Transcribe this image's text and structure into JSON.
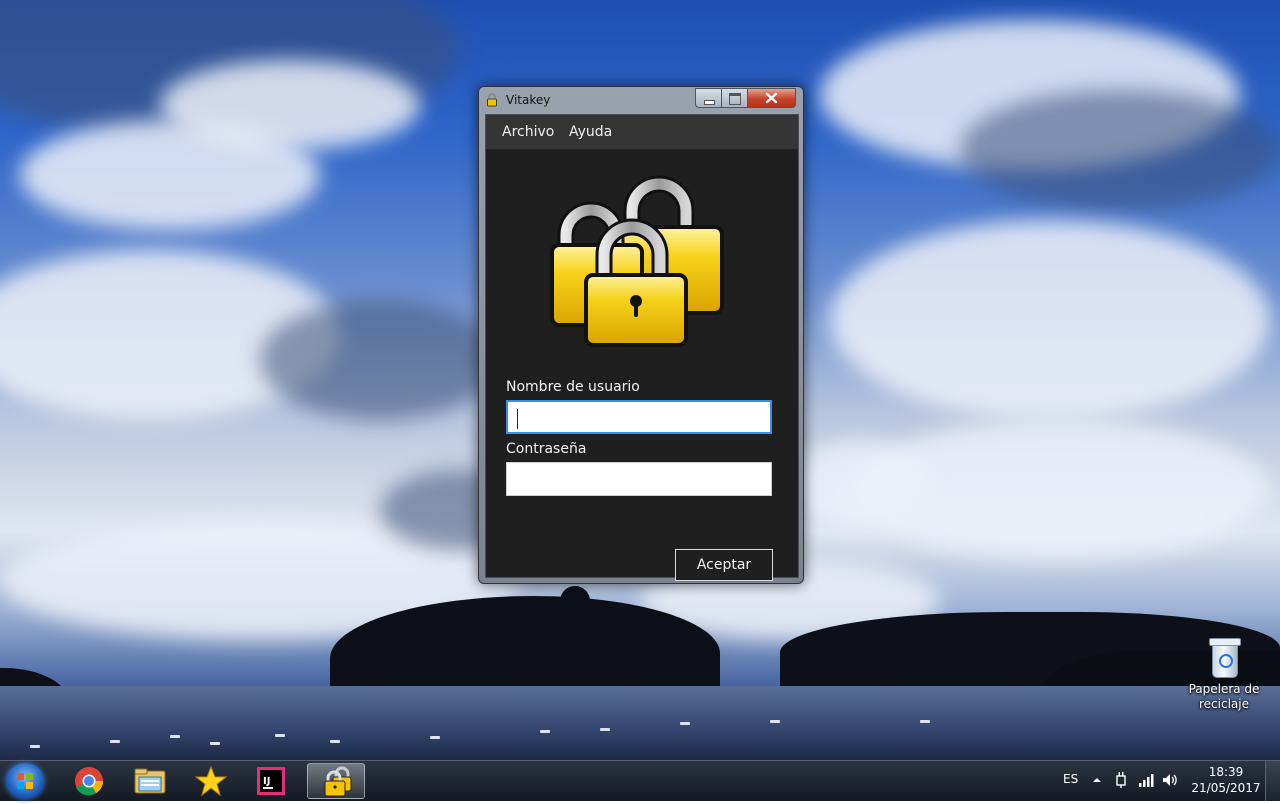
{
  "window": {
    "title": "Vitakey",
    "menu": [
      "Archivo",
      "Ayuda"
    ],
    "username_label": "Nombre de usuario",
    "username_value": "",
    "password_label": "Contraseña",
    "password_value": "",
    "accept_label": "Aceptar",
    "controls": {
      "minimize": "minimize-icon",
      "maximize": "maximize-icon",
      "close": "close-icon"
    },
    "icon": "padlocks-icon"
  },
  "desktop": {
    "recycle_bin_label": "Papelera de reciclaje"
  },
  "taskbar": {
    "pinned": [
      "chrome-icon",
      "file-explorer-icon",
      "favorites-star-icon",
      "intellij-idea-icon",
      "vitakey-icon"
    ],
    "active_app": "Vitakey",
    "language": "ES",
    "time": "18:39",
    "date": "21/05/2017"
  },
  "colors": {
    "window_bg": "#1f1f1f",
    "menubar_bg": "#353535",
    "focus_border": "#3a8ee6",
    "lock_gold": "#f5c400"
  }
}
